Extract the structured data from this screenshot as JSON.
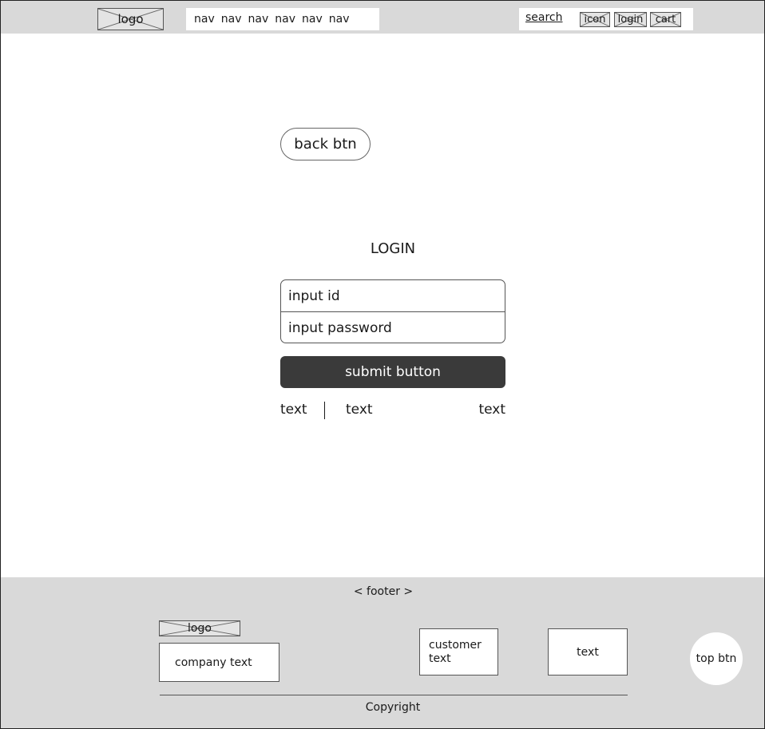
{
  "header": {
    "logo": "logo",
    "nav_items": [
      "nav",
      "nav",
      "nav",
      "nav",
      "nav",
      "nav"
    ],
    "search": "search",
    "icon_label": "icon",
    "login_label": "login",
    "cart_label": "cart"
  },
  "main": {
    "back_button": "back btn",
    "title": "LOGIN",
    "id_input": "input id",
    "password_input": "input password",
    "submit": "submit button",
    "links": [
      "text",
      "text",
      "text"
    ]
  },
  "footer": {
    "label": "< footer >",
    "logo": "logo",
    "company_text": "company text",
    "customer_text": "customer text",
    "text": "text",
    "top_button": "top btn",
    "copyright": "Copyright"
  },
  "colors": {
    "header_bg": "#d9d9d9",
    "footer_bg": "#d9d9d9",
    "submit_bg": "#3a3a3a"
  }
}
